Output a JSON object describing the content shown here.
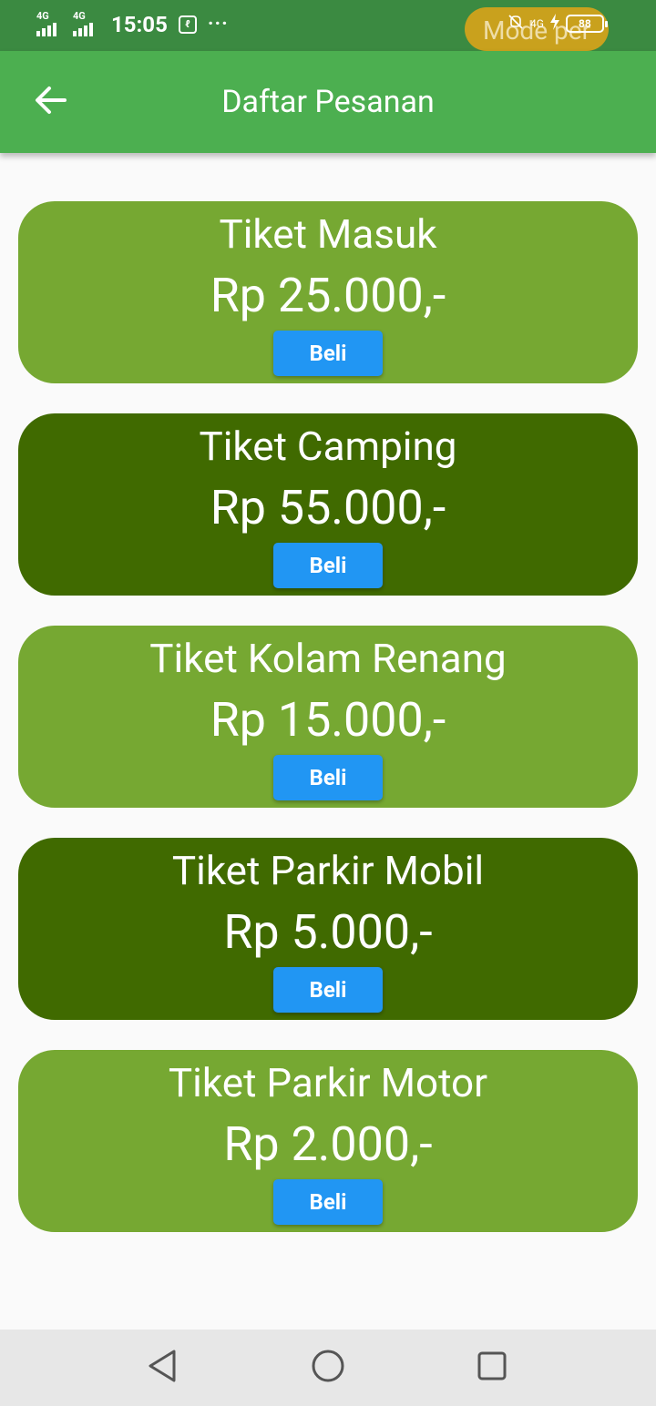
{
  "status_bar": {
    "net1": "4G",
    "net2": "4G",
    "time": "15:05",
    "more": "···",
    "app_icon_glyph": "ℓ",
    "pill_text": "Mode per",
    "net_right": "4G",
    "battery": "88"
  },
  "appbar": {
    "title": "Daftar Pesanan",
    "back_icon": "arrow-left-icon"
  },
  "products": [
    {
      "name": "Tiket Masuk",
      "price": "Rp 25.000,-",
      "button": "Beli",
      "color": "#76a832"
    },
    {
      "name": "Tiket Camping",
      "price": "Rp 55.000,-",
      "button": "Beli",
      "color": "#406a00"
    },
    {
      "name": "Tiket Kolam Renang",
      "price": "Rp 15.000,-",
      "button": "Beli",
      "color": "#76a832"
    },
    {
      "name": "Tiket Parkir Mobil",
      "price": "Rp 5.000,-",
      "button": "Beli",
      "color": "#406a00"
    },
    {
      "name": "Tiket Parkir Motor",
      "price": "Rp 2.000,-",
      "button": "Beli",
      "color": "#76a832"
    }
  ],
  "colors": {
    "status_bar": "#3b8a41",
    "app_bar": "#4caf50",
    "button": "#2196f3",
    "card_light": "#76a832",
    "card_dark": "#406a00"
  },
  "nav_bar": {
    "back": "back-triangle-icon",
    "home": "home-circle-icon",
    "recents": "recents-square-icon"
  }
}
